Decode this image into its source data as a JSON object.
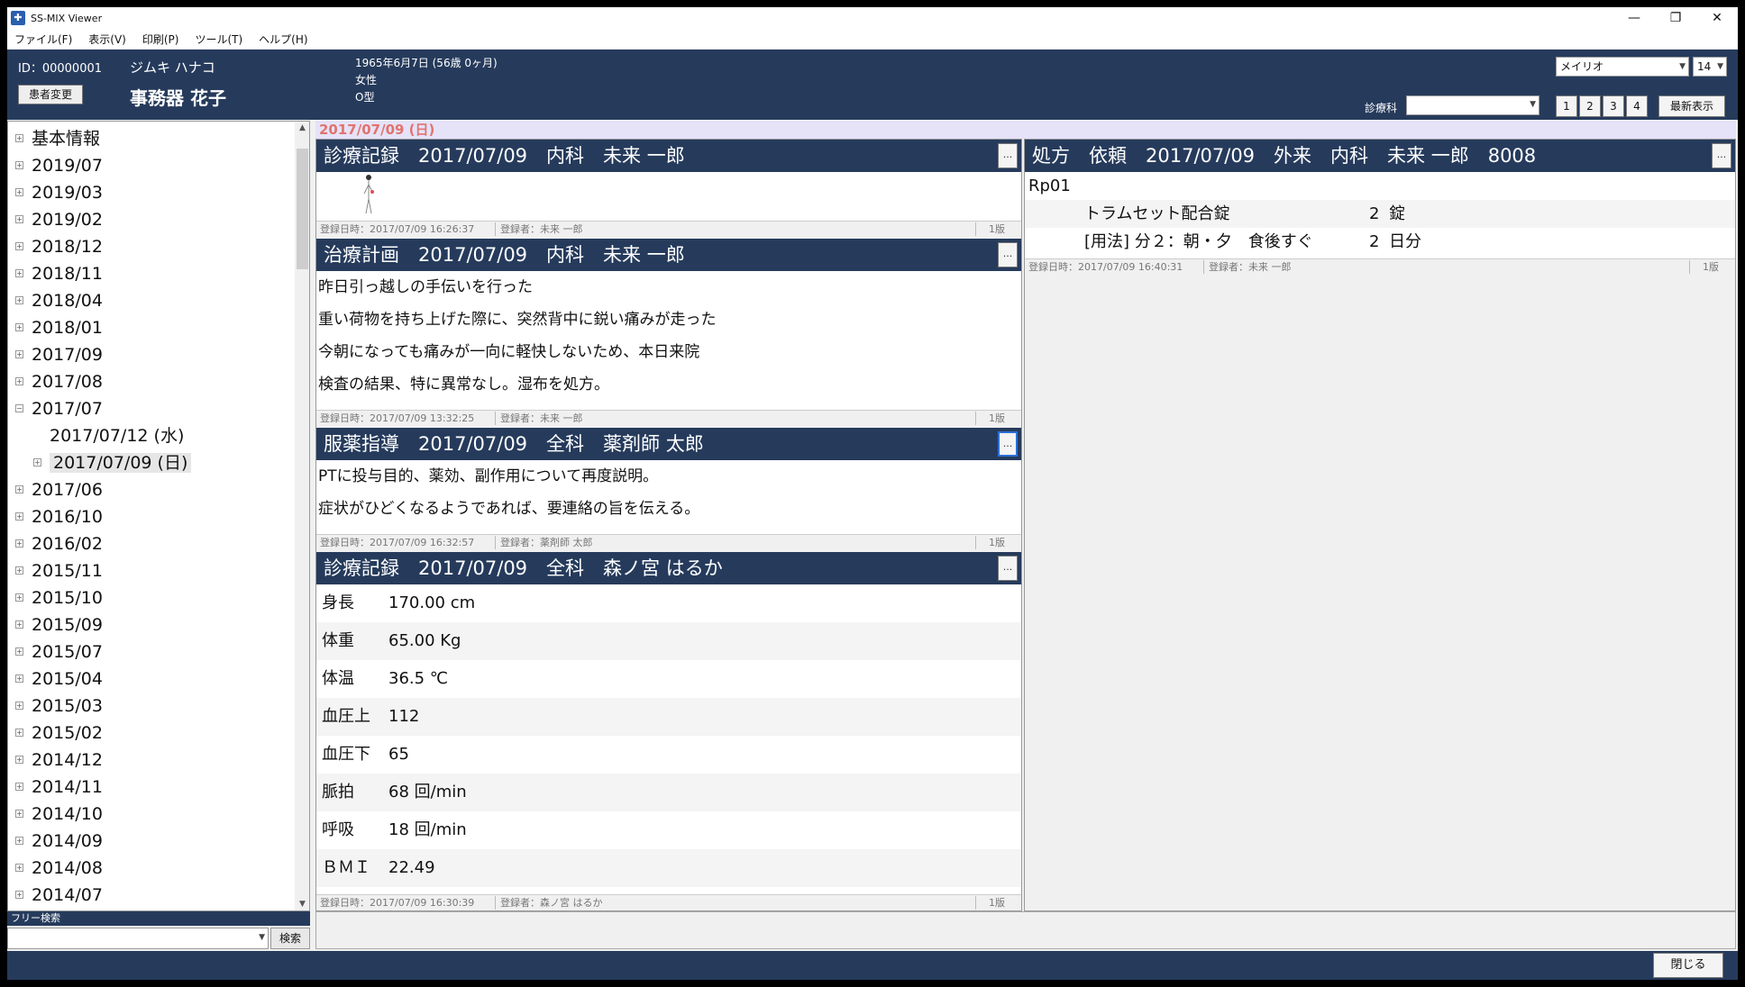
{
  "window": {
    "title": "SS-MIX Viewer",
    "minimize": "—",
    "maximize": "❐",
    "close": "✕"
  },
  "menu": [
    "ファイル(F)",
    "表示(V)",
    "印刷(P)",
    "ツール(T)",
    "ヘルプ(H)"
  ],
  "patient": {
    "id": "ID：00000001",
    "kana": "ジムキ ハナコ",
    "name": "事務器 花子",
    "change_button": "患者変更",
    "birth": "1965年6月7日 (56歳 0ヶ月)",
    "sex": "女性",
    "blood": "O型"
  },
  "toolbar": {
    "font": "メイリオ",
    "font_size": "14",
    "dept_label": "診療科",
    "dept_value": "",
    "pages": [
      "1",
      "2",
      "3",
      "4"
    ],
    "latest_button": "最新表示"
  },
  "tree": {
    "items": [
      {
        "label": "基本情報",
        "exp": "+"
      },
      {
        "label": "2019/07",
        "exp": "+"
      },
      {
        "label": "2019/03",
        "exp": "+"
      },
      {
        "label": "2019/02",
        "exp": "+"
      },
      {
        "label": "2018/12",
        "exp": "+"
      },
      {
        "label": "2018/11",
        "exp": "+"
      },
      {
        "label": "2018/04",
        "exp": "+"
      },
      {
        "label": "2018/01",
        "exp": "+"
      },
      {
        "label": "2017/09",
        "exp": "+"
      },
      {
        "label": "2017/08",
        "exp": "+"
      },
      {
        "label": "2017/07",
        "exp": "−"
      },
      {
        "label": "2017/07/12 (水)",
        "exp": ""
      },
      {
        "label": "2017/07/09 (日)",
        "exp": "+"
      },
      {
        "label": "2017/06",
        "exp": "+"
      },
      {
        "label": "2016/10",
        "exp": "+"
      },
      {
        "label": "2016/02",
        "exp": "+"
      },
      {
        "label": "2015/11",
        "exp": "+"
      },
      {
        "label": "2015/10",
        "exp": "+"
      },
      {
        "label": "2015/09",
        "exp": "+"
      },
      {
        "label": "2015/07",
        "exp": "+"
      },
      {
        "label": "2015/04",
        "exp": "+"
      },
      {
        "label": "2015/03",
        "exp": "+"
      },
      {
        "label": "2015/02",
        "exp": "+"
      },
      {
        "label": "2014/12",
        "exp": "+"
      },
      {
        "label": "2014/11",
        "exp": "+"
      },
      {
        "label": "2014/10",
        "exp": "+"
      },
      {
        "label": "2014/09",
        "exp": "+"
      },
      {
        "label": "2014/08",
        "exp": "+"
      },
      {
        "label": "2014/07",
        "exp": "+"
      }
    ]
  },
  "search": {
    "label": "フリー検索",
    "value": "",
    "button": "検索"
  },
  "date_bar": "2017/07/09 (日)",
  "cards": {
    "record1": {
      "title": "診療記録　2017/07/09　内科　未来 一郎",
      "foot_date": "登録日時：2017/07/09 16:26:37",
      "foot_user": "登録者：未来 一郎",
      "version": "1版"
    },
    "plan": {
      "title": "治療計画　2017/07/09　内科　未来 一郎",
      "lines": [
        "昨日引っ越しの手伝いを行った",
        "重い荷物を持ち上げた際に、突然背中に鋭い痛みが走った",
        "今朝になっても痛みが一向に軽快しないため、本日来院",
        "検査の結果、特に異常なし。湿布を処方。"
      ],
      "foot_date": "登録日時：2017/07/09 13:32:25",
      "foot_user": "登録者：未来 一郎",
      "version": "1版"
    },
    "med": {
      "title": "服薬指導　2017/07/09　全科　薬剤師 太郎",
      "lines": [
        "PTに投与目的、薬効、副作用について再度説明。",
        "症状がひどくなるようであれば、要連絡の旨を伝える。"
      ],
      "foot_date": "登録日時：2017/07/09 16:32:57",
      "foot_user": "登録者：薬剤師 太郎",
      "version": "1版"
    },
    "vitals": {
      "title": "診療記録　2017/07/09　全科　森ノ宮 はるか",
      "rows": [
        {
          "label": "身長",
          "value": "170.00 cm"
        },
        {
          "label": "体重",
          "value": "65.00 Kg"
        },
        {
          "label": "体温",
          "value": "36.5 ℃"
        },
        {
          "label": "血圧上",
          "value": "112"
        },
        {
          "label": "血圧下",
          "value": "65"
        },
        {
          "label": "脈拍",
          "value": "68 回/min"
        },
        {
          "label": "呼吸",
          "value": "18 回/min"
        },
        {
          "label": "ＢＭＩ",
          "value": "22.49"
        }
      ],
      "foot_date": "登録日時：2017/07/09 16:30:39",
      "foot_user": "登録者：森ノ宮 はるか",
      "version": "1版"
    },
    "rx": {
      "title": "処方　依頼　2017/07/09　外来　内科　未来 一郎　8008",
      "rp": "Rp01",
      "drug": "トラムセット配合錠",
      "drug_qty": "2",
      "drug_unit": "錠",
      "usage": "[用法] 分２：朝・夕　食後すぐ",
      "usage_qty": "2",
      "usage_unit": "日分",
      "foot_date": "登録日時：2017/07/09 16:40:31",
      "foot_user": "登録者：未来 一郎",
      "version": "1版"
    }
  },
  "card_menu": "...",
  "close_button": "閉じる",
  "colors": {
    "header_bg": "#263b5c",
    "date_bar_bg": "#e6e2f8",
    "date_text": "#e0746e"
  }
}
